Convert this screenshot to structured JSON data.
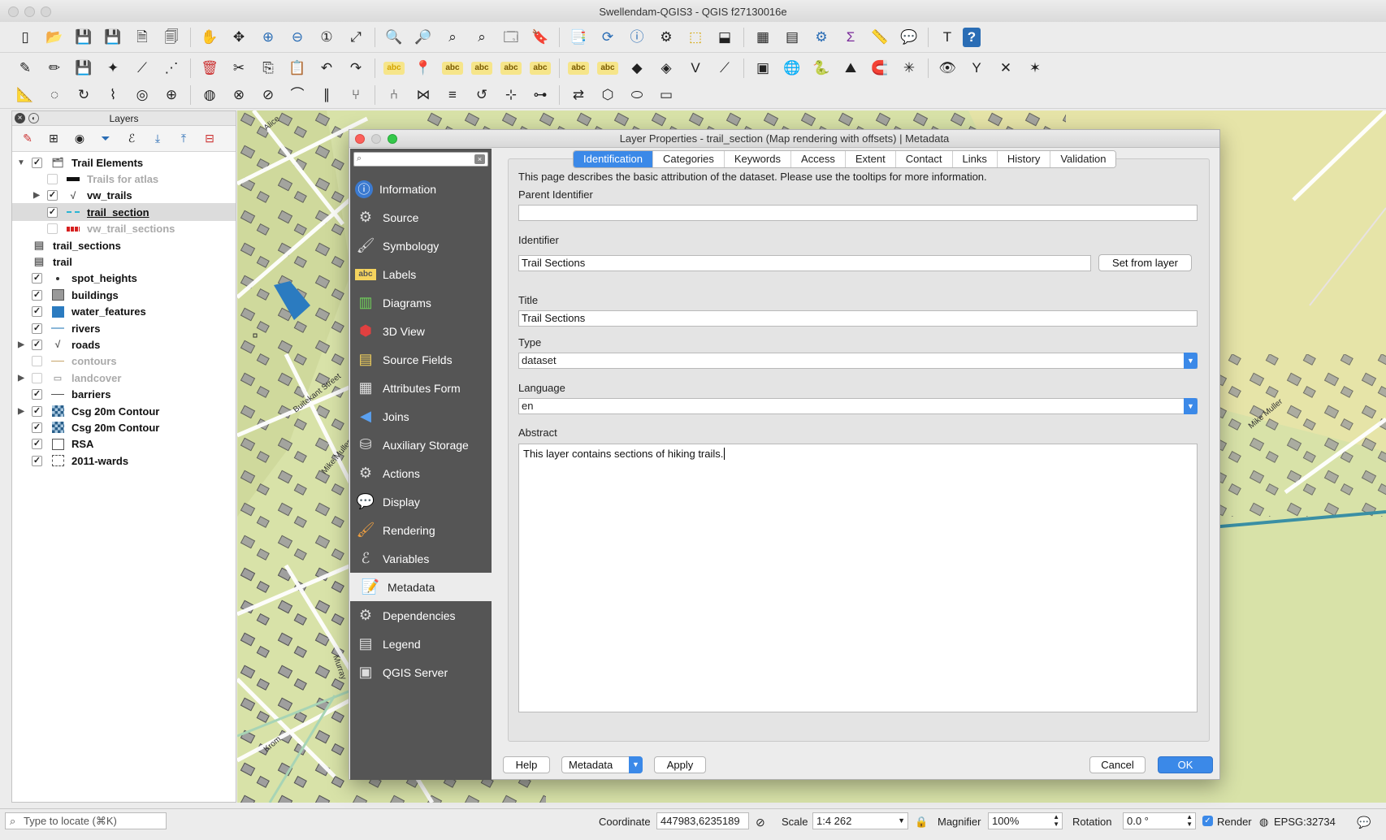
{
  "window": {
    "title": "Swellendam-QGIS3 - QGIS f27130016e"
  },
  "toolbar_icons": {
    "row1": [
      "new-project-icon",
      "open-project-icon",
      "save-project-icon",
      "save-as-icon",
      "new-print-layout-icon",
      "layout-manager-icon",
      "pan-icon",
      "pan-to-selection-icon",
      "zoom-in-icon",
      "zoom-out-icon",
      "zoom-native-icon",
      "zoom-full-icon",
      "zoom-selection-icon",
      "zoom-layer-icon",
      "zoom-last-icon",
      "zoom-next-icon",
      "new-map-view-icon",
      "new-bookmark-icon",
      "show-bookmarks-icon",
      "refresh-icon",
      "identify-icon",
      "measure-icon",
      "select-icon",
      "deselect-icon",
      "attribute-table-icon",
      "field-calculator-icon",
      "toolbox-icon",
      "statistics-icon",
      "measure-line-icon",
      "map-tips-icon",
      "text-annotation-icon",
      "help-icon"
    ],
    "row2": [
      "current-edits-icon",
      "toggle-editing-icon",
      "save-edits-icon",
      "digitize-icon",
      "vertex-tool-icon",
      "node-tool-icon",
      "delete-selected-icon",
      "cut-features-icon",
      "copy-features-icon",
      "paste-features-icon",
      "undo-icon",
      "redo-icon",
      "label-icon",
      "label-pin-icon",
      "label-highlight-icon",
      "label-show-icon",
      "label-move-icon",
      "label-rotate-icon",
      "label-change-icon",
      "label-diagram-icon",
      "add-layer-icon",
      "add-vector-icon",
      "add-delimited-icon",
      "add-wms-icon",
      "add-spatialite-icon",
      "globe-icon",
      "python-icon",
      "georeferencer-icon",
      "snapping-magnet-icon",
      "trace-icon",
      "topology-icon",
      "split-icon",
      "reshape-icon",
      "offset-icon"
    ],
    "row3": [
      "digitize-advanced-icon",
      "circular-string-icon",
      "rotate-feature-icon",
      "simplify-icon",
      "add-ring-icon",
      "add-part-icon",
      "fill-ring-icon",
      "delete-ring-icon",
      "delete-part-icon",
      "reshape-feature-icon",
      "offset-curve-icon",
      "split-feature-icon",
      "split-parts-icon",
      "merge-features-icon",
      "merge-attributes-icon",
      "rotate-point-icon",
      "align-icon",
      "move-label-icon",
      "reverse-icon",
      "regular-shape-icon",
      "ellipse-icon",
      "rectangle-icon"
    ]
  },
  "layers_panel": {
    "title": "Layers",
    "layers": [
      {
        "label": "Trail Elements",
        "checked": true,
        "arrow": "▼",
        "symbol": "group-icon",
        "indent": 0
      },
      {
        "label": "Trails for atlas",
        "checked": false,
        "arrow": "",
        "symbol": "black-line-symbol",
        "indent": 1,
        "disabled": true
      },
      {
        "label": "vw_trails",
        "checked": true,
        "arrow": "▶",
        "symbol": "rule-line-symbol",
        "indent": 1
      },
      {
        "label": "trail_section",
        "checked": true,
        "arrow": "",
        "symbol": "cyan-dash-symbol",
        "indent": 1,
        "selected": true
      },
      {
        "label": "vw_trail_sections",
        "checked": false,
        "arrow": "",
        "symbol": "red-line-symbol",
        "indent": 1,
        "disabled": true
      },
      {
        "label": "trail_sections",
        "checked": null,
        "arrow": "",
        "symbol": "table-icon",
        "indent": 0
      },
      {
        "label": "trail",
        "checked": null,
        "arrow": "",
        "symbol": "table-icon",
        "indent": 0
      },
      {
        "label": "spot_heights",
        "checked": true,
        "arrow": "",
        "symbol": "dot-symbol",
        "indent": 0
      },
      {
        "label": "buildings",
        "checked": true,
        "arrow": "",
        "symbol": "gray-fill-symbol",
        "indent": 0
      },
      {
        "label": "water_features",
        "checked": true,
        "arrow": "",
        "symbol": "blue-fill-symbol",
        "indent": 0
      },
      {
        "label": "rivers",
        "checked": true,
        "arrow": "",
        "symbol": "river-line-symbol",
        "indent": 0
      },
      {
        "label": "roads",
        "checked": true,
        "arrow": "▶",
        "symbol": "rule-line-symbol",
        "indent": 0
      },
      {
        "label": "contours",
        "checked": false,
        "arrow": "",
        "symbol": "contour-line-symbol",
        "indent": 0,
        "disabled": true
      },
      {
        "label": "landcover",
        "checked": false,
        "arrow": "▶",
        "symbol": "landcover-symbol",
        "indent": 0,
        "disabled": true
      },
      {
        "label": "barriers",
        "checked": true,
        "arrow": "",
        "symbol": "barrier-line-symbol",
        "indent": 0
      },
      {
        "label": "Csg 20m Contour",
        "checked": true,
        "arrow": "▶",
        "symbol": "raster-icon",
        "indent": 0
      },
      {
        "label": "Csg 20m Contour",
        "checked": true,
        "arrow": "",
        "symbol": "raster-icon",
        "indent": 0
      },
      {
        "label": "RSA",
        "checked": true,
        "arrow": "",
        "symbol": "empty-fill-symbol",
        "indent": 0
      },
      {
        "label": "2011-wards",
        "checked": true,
        "arrow": "",
        "symbol": "dashed-fill-symbol",
        "indent": 0
      }
    ]
  },
  "map_labels": [
    "Alice",
    "Buitekant Street",
    "Mike Muller",
    "Murray",
    "Krom"
  ],
  "dialog": {
    "title": "Layer Properties - trail_section (Map rendering with offsets) | Metadata",
    "search_placeholder": "",
    "nav": [
      {
        "label": "Information",
        "icon": "information-icon"
      },
      {
        "label": "Source",
        "icon": "source-icon"
      },
      {
        "label": "Symbology",
        "icon": "symbology-icon"
      },
      {
        "label": "Labels",
        "icon": "labels-icon"
      },
      {
        "label": "Diagrams",
        "icon": "diagrams-icon"
      },
      {
        "label": "3D View",
        "icon": "3d-view-icon"
      },
      {
        "label": "Source Fields",
        "icon": "source-fields-icon"
      },
      {
        "label": "Attributes Form",
        "icon": "attributes-form-icon"
      },
      {
        "label": "Joins",
        "icon": "joins-icon"
      },
      {
        "label": "Auxiliary Storage",
        "icon": "auxiliary-storage-icon"
      },
      {
        "label": "Actions",
        "icon": "actions-icon"
      },
      {
        "label": "Display",
        "icon": "display-icon"
      },
      {
        "label": "Rendering",
        "icon": "rendering-icon"
      },
      {
        "label": "Variables",
        "icon": "variables-icon"
      },
      {
        "label": "Metadata",
        "icon": "metadata-icon",
        "active": true
      },
      {
        "label": "Dependencies",
        "icon": "dependencies-icon"
      },
      {
        "label": "Legend",
        "icon": "legend-icon"
      },
      {
        "label": "QGIS Server",
        "icon": "qgis-server-icon"
      }
    ],
    "tabs": [
      "Identification",
      "Categories",
      "Keywords",
      "Access",
      "Extent",
      "Contact",
      "Links",
      "History",
      "Validation"
    ],
    "active_tab": "Identification",
    "description": "This page describes the basic attribution of the dataset. Please use the tooltips for more information.",
    "parent_identifier": {
      "label": "Parent Identifier",
      "value": ""
    },
    "identifier": {
      "label": "Identifier",
      "value": "Trail Sections",
      "button": "Set from layer"
    },
    "title_field": {
      "label": "Title",
      "value": "Trail Sections"
    },
    "type_field": {
      "label": "Type",
      "value": "dataset"
    },
    "language_field": {
      "label": "Language",
      "value": "en"
    },
    "abstract": {
      "label": "Abstract",
      "value": "This layer contains sections of hiking trails."
    },
    "buttons": {
      "help": "Help",
      "metadata": "Metadata",
      "apply": "Apply",
      "cancel": "Cancel",
      "ok": "OK"
    }
  },
  "statusbar": {
    "locate_placeholder": "Type to locate (⌘K)",
    "coordinate_label": "Coordinate",
    "coordinate_value": "447983,6235189",
    "scale_label": "Scale",
    "scale_value": "1:4 262",
    "magnifier_label": "Magnifier",
    "magnifier_value": "100%",
    "rotation_label": "Rotation",
    "rotation_value": "0.0 °",
    "render_label": "Render",
    "crs": "EPSG:32734"
  },
  "colors": {
    "accent": "#3b89e8",
    "sidebar": "#555555",
    "map_base": "#d8e2a8",
    "water": "#2b7bc0"
  }
}
